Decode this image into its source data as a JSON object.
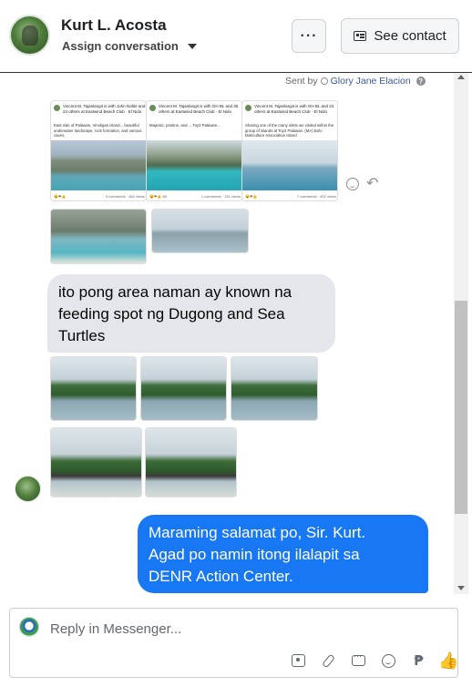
{
  "header": {
    "contact_name": "Kurt L. Acosta",
    "assign_label": "Assign conversation",
    "more_label": "···",
    "see_contact_label": "See contact"
  },
  "conversation": {
    "sent_by_prefix": "Sent by",
    "sent_by_name": "Glory Jane Elacion",
    "shared_posts": [
      {
        "author": "Vincent M. Tajanlangit is with John Noble and 24 others at Eastwind Beach Club · El Nido",
        "text": "East side of Palawan, Vinoligan island... beautiful underwater landscape, rock formation, and various caves.",
        "footer_left": "😮❤👍",
        "footer_right": "9 comments · 482 views"
      },
      {
        "author": "Vincent M. Tajanlangit is with GH BL and 35 others at Eastwind Beach Club · El Nido",
        "text": "Majestic, pristine, and ... Toy2 Palawan...",
        "footer_left": "😮❤👍 88",
        "footer_right": "1 comments · 231 views"
      },
      {
        "author": "Vincent M. Tajanlangit is with GH BL and 24 others at Eastwind Beach Club · El Nido",
        "text": "Sharing one of the many islets we visited within the group of islands at Toy2 Palawan. (MA) Bolo Mariculture Association island",
        "footer_left": "😮❤👍",
        "footer_right": "7 comments · 402 views"
      }
    ],
    "incoming_message_lines": [
      "ito pong area naman ay known na",
      "feeding spot ng Dugong and Sea",
      "Turtles"
    ],
    "outgoing_message_lines": [
      "Maraming salamat po, Sir. Kurt.",
      "Agad po namin itong ilalapit sa",
      "DENR Action Center."
    ]
  },
  "composer": {
    "placeholder": "Reply in Messenger...",
    "peso_symbol": "₱",
    "like_symbol": "👍"
  },
  "icons": {
    "more": "more-options-icon",
    "contact": "contact-card-icon",
    "react": "smile-icon",
    "reply": "reply-icon",
    "saved_replies": "saved-replies-icon",
    "attach": "paperclip-icon",
    "chat": "chat-icon",
    "emoji": "emoji-icon",
    "payment": "peso-icon",
    "like": "thumbs-up-icon"
  },
  "colors": {
    "outgoing_bubble": "#1877f2",
    "incoming_bubble": "#e4e6eb",
    "link": "#385898"
  }
}
